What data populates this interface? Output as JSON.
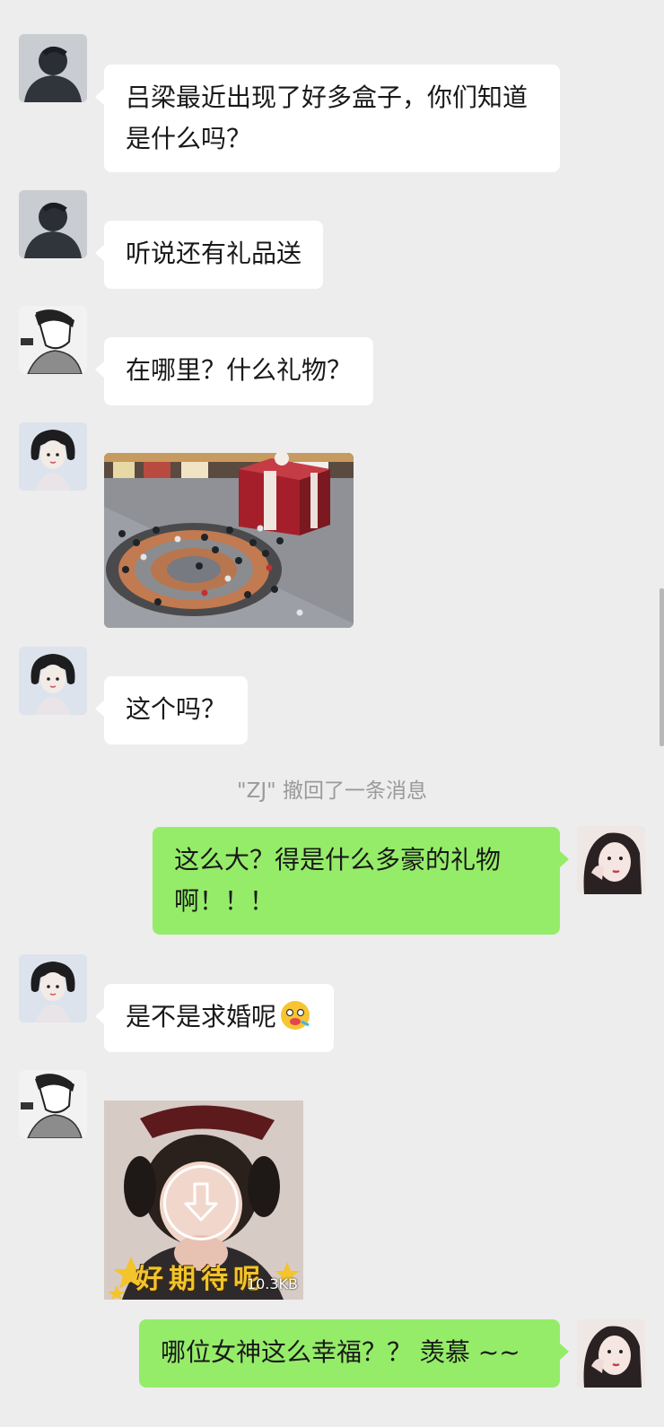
{
  "messages": [
    {
      "text": "吕梁最近出现了好多盒子，你们知道是什么吗？"
    },
    {
      "text": "听说还有礼品送"
    },
    {
      "text": "在哪里？什么礼物？"
    },
    {
      "text": "这个吗？"
    },
    {
      "text": "这么大？得是什么多豪的礼物啊！！！"
    },
    {
      "text": "是不是求婚呢"
    },
    {
      "text": "哪位女神这么幸福？？ 羡慕 ~~"
    }
  ],
  "system_notice": "\"ZJ\" 撤回了一条消息",
  "sticker": {
    "caption": "好期待呢",
    "size": "10.3KB",
    "download_icon": "download-arrow-icon"
  },
  "colors": {
    "background": "#ededed",
    "bubble_in": "#ffffff",
    "bubble_out": "#95ec69",
    "system_text": "#9a9a9a"
  }
}
